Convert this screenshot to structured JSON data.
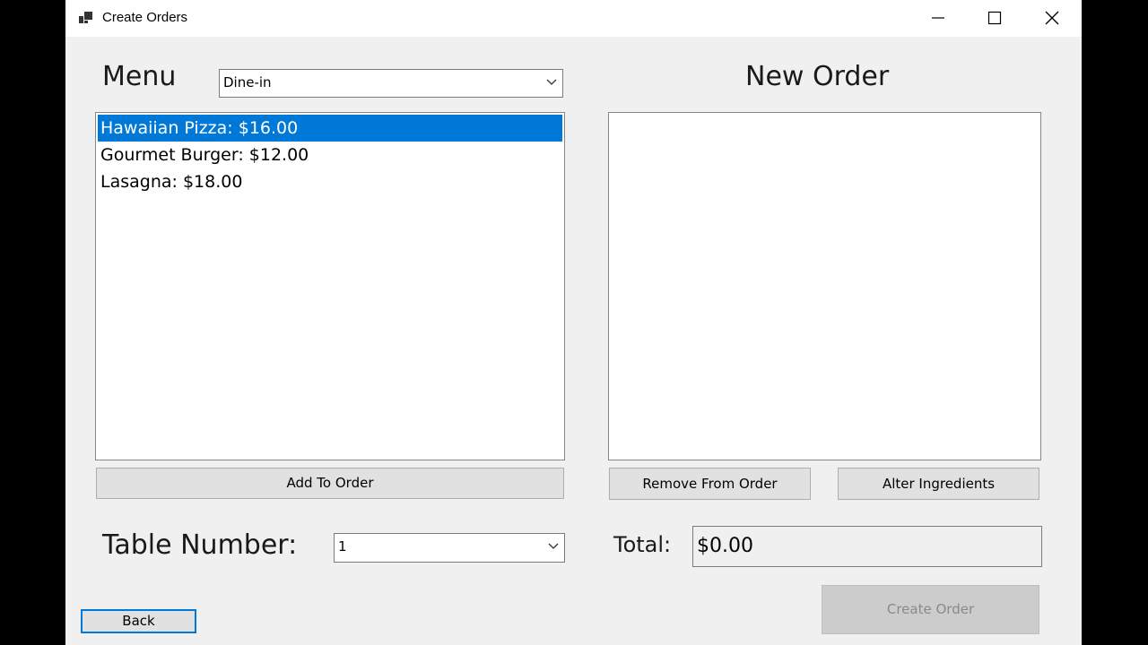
{
  "window": {
    "title": "Create Orders",
    "icons": {
      "app": "app-window-icon",
      "minimize": "minimize-icon",
      "maximize": "maximize-icon",
      "close": "close-icon"
    }
  },
  "menu": {
    "label": "Menu",
    "mode_select": {
      "value": "Dine-in"
    },
    "items": [
      {
        "label": "Hawaiian Pizza: $16.00",
        "selected": true
      },
      {
        "label": "Gourmet Burger: $12.00",
        "selected": false
      },
      {
        "label": "Lasagna: $18.00",
        "selected": false
      }
    ],
    "add_button": "Add To Order"
  },
  "order": {
    "label": "New Order",
    "items": [],
    "remove_button": "Remove From Order",
    "alter_button": "Alter Ingredients"
  },
  "table": {
    "label": "Table Number:",
    "value": "1"
  },
  "total": {
    "label": "Total:",
    "value": "$0.00"
  },
  "footer": {
    "back_button": "Back",
    "create_button": "Create Order"
  },
  "colors": {
    "selection": "#0078d7",
    "window_bg": "#f0f0f0",
    "disabled_button": "#cccccc"
  }
}
